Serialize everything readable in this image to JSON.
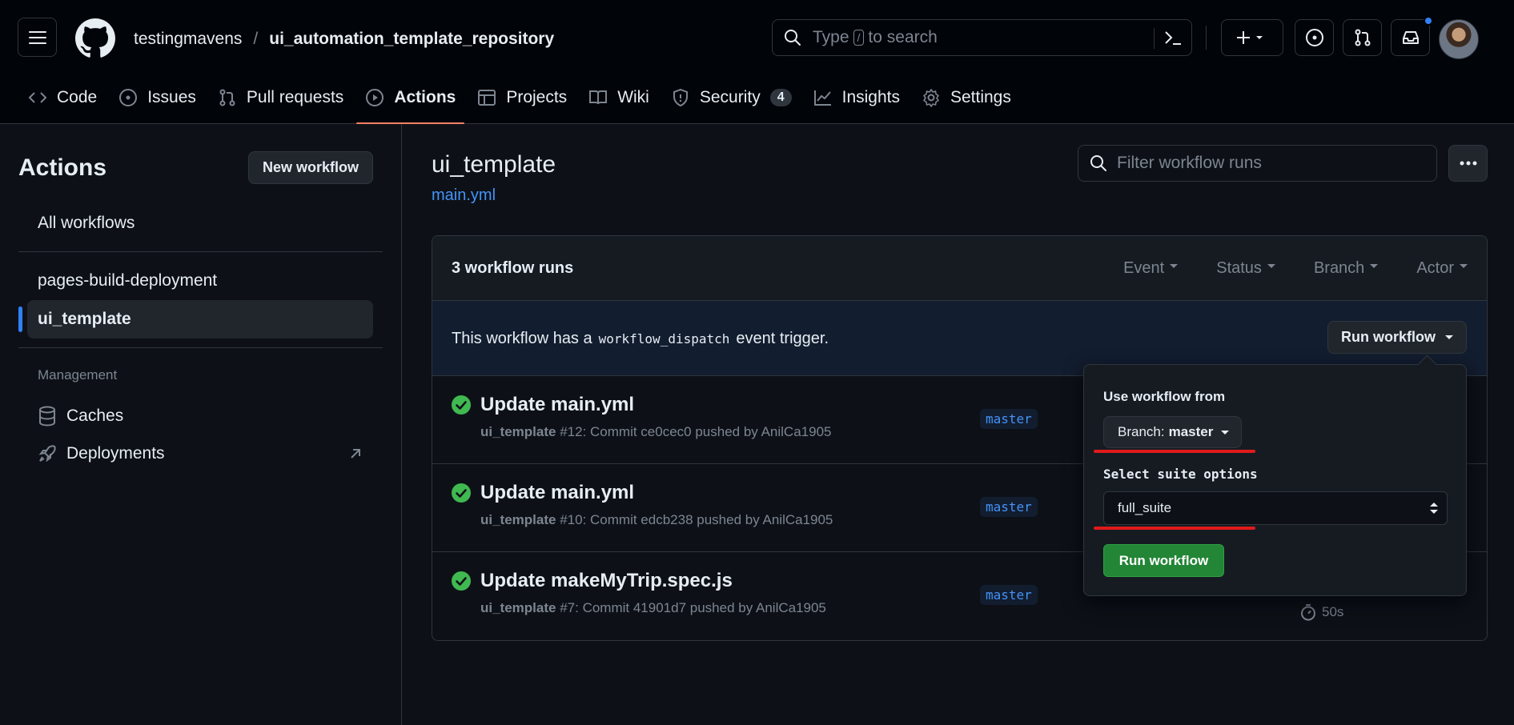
{
  "header": {
    "owner": "testingmavens",
    "separator": "/",
    "repo": "ui_automation_template_repository",
    "search_prefix": "Type",
    "search_key": "/",
    "search_suffix": "to search"
  },
  "tabs": [
    {
      "label": "Code",
      "icon": "code-icon"
    },
    {
      "label": "Issues",
      "icon": "issue-icon"
    },
    {
      "label": "Pull requests",
      "icon": "pull-request-icon"
    },
    {
      "label": "Actions",
      "icon": "play-icon",
      "active": true
    },
    {
      "label": "Projects",
      "icon": "table-icon"
    },
    {
      "label": "Wiki",
      "icon": "book-icon"
    },
    {
      "label": "Security",
      "icon": "shield-icon",
      "count": "4"
    },
    {
      "label": "Insights",
      "icon": "graph-icon"
    },
    {
      "label": "Settings",
      "icon": "gear-icon"
    }
  ],
  "sidebar": {
    "title": "Actions",
    "new_workflow": "New workflow",
    "all_workflows": "All workflows",
    "workflows": [
      "pages-build-deployment",
      "ui_template"
    ],
    "management_label": "Management",
    "caches": "Caches",
    "deployments": "Deployments"
  },
  "main": {
    "workflow_title": "ui_template",
    "workflow_file": "main.yml",
    "filter_placeholder": "Filter workflow runs",
    "runs_count": "3 workflow runs",
    "filters": [
      "Event",
      "Status",
      "Branch",
      "Actor"
    ],
    "dispatch_prefix": "This workflow has a",
    "dispatch_code": "workflow_dispatch",
    "dispatch_suffix": "event trigger.",
    "run_workflow_dropdown": "Run workflow"
  },
  "runs": [
    {
      "title": "Update main.yml",
      "workflow": "ui_template",
      "detail": "#12: Commit ce0cec0 pushed by AnilCa1905",
      "branch": "master"
    },
    {
      "title": "Update main.yml",
      "workflow": "ui_template",
      "detail": "#10: Commit edcb238 pushed by AnilCa1905",
      "branch": "master"
    },
    {
      "title": "Update makeMyTrip.spec.js",
      "workflow": "ui_template",
      "detail": "#7: Commit 41901d7 pushed by AnilCa1905",
      "branch": "master",
      "duration": "50s"
    }
  ],
  "popover": {
    "use_from_label": "Use workflow from",
    "branch_prefix": "Branch:",
    "branch_value": "master",
    "suite_label": "Select suite options",
    "suite_value": "full_suite",
    "run_button": "Run workflow"
  },
  "colors": {
    "background": "#0d1117",
    "accent_link": "#4493f8",
    "active_tab_underline": "#f78166",
    "success": "#3fb950",
    "run_button": "#238636",
    "annotation": "#e01a1a"
  }
}
